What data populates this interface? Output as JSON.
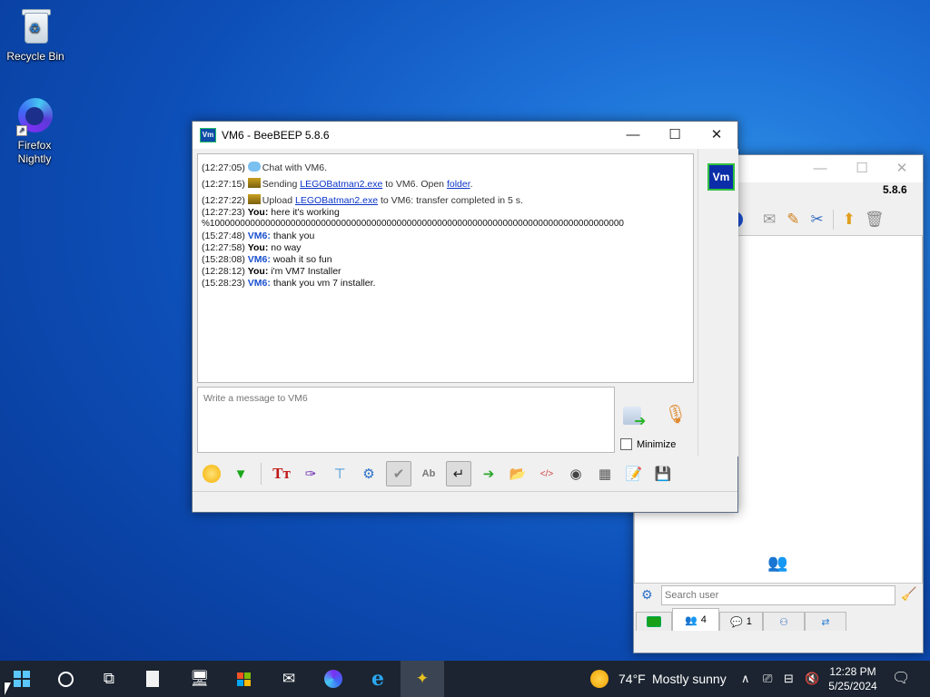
{
  "desktop": {
    "icons": [
      {
        "label": "Recycle Bin"
      },
      {
        "label": "Firefox\nNightly"
      }
    ]
  },
  "back_window": {
    "version": "5.8.6",
    "search_placeholder": "Search user",
    "tabs": [
      {
        "icon": "network-icon",
        "count": ""
      },
      {
        "icon": "users-icon",
        "count": "4"
      },
      {
        "icon": "chats-icon",
        "count": "1"
      },
      {
        "icon": "groups-icon",
        "count": ""
      },
      {
        "icon": "share-icon",
        "count": ""
      }
    ]
  },
  "chat_window": {
    "title": "VM6 - BeeBEEP 5.8.6",
    "badge": "Vm",
    "messages": [
      {
        "time": "(12:27:05)",
        "kind": "system",
        "text": "Chat with VM6."
      },
      {
        "time": "(12:27:15)",
        "kind": "system",
        "pre": "Sending ",
        "link": "LEGOBatman2.exe",
        "mid": " to VM6. Open ",
        "link2": "folder",
        "post": "."
      },
      {
        "time": "(12:27:22)",
        "kind": "system",
        "pre": "Upload ",
        "link": "LEGOBatman2.exe",
        "post": " to VM6: transfer completed in 5 s."
      },
      {
        "time": "(12:27:23)",
        "kind": "you",
        "sender": "You:",
        "text": "here it's working"
      },
      {
        "time": "",
        "kind": "raw",
        "text": "%1000000000000000000000000000000000000000000000000000000000000000000000000000000000"
      },
      {
        "time": "(15:27:48)",
        "kind": "vm6",
        "sender": "VM6:",
        "text": "thank you"
      },
      {
        "time": "(12:27:58)",
        "kind": "you",
        "sender": "You:",
        "text": "no way"
      },
      {
        "time": "(15:28:08)",
        "kind": "vm6",
        "sender": "VM6:",
        "text": "woah it so fun"
      },
      {
        "time": "(12:28:12)",
        "kind": "you",
        "sender": "You:",
        "text": "i'm VM7 Installer"
      },
      {
        "time": "(15:28:23)",
        "kind": "vm6",
        "sender": "VM6:",
        "text": "thank you vm 7 installer."
      }
    ],
    "input_placeholder": "Write a message to VM6",
    "minimize_label": "Minimize"
  },
  "taskbar": {
    "weather_temp": "74°F",
    "weather_text": "Mostly sunny",
    "time": "12:28 PM",
    "date": "5/25/2024"
  },
  "colors": {
    "accent_blue": "#1a4fcf",
    "taskbar": "#1b2430",
    "badge": "#0b2ea8"
  }
}
